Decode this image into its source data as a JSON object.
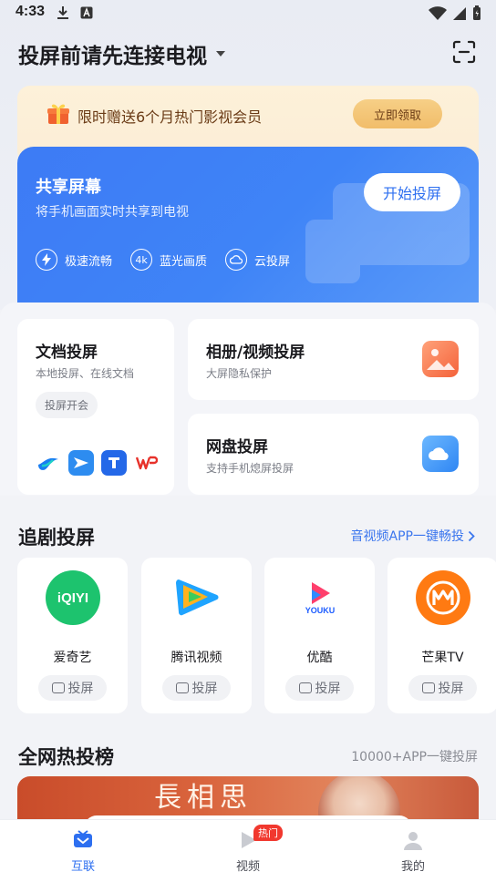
{
  "status_bar": {
    "time": "4:33"
  },
  "header": {
    "title": "投屏前请先连接电视"
  },
  "promo": {
    "text": "限时赠送6个月热门影视会员",
    "button": "立即领取"
  },
  "share": {
    "title": "共享屏幕",
    "subtitle": "将手机画面实时共享到电视",
    "button": "开始投屏",
    "features": [
      {
        "icon": "lightning-icon",
        "label": "极速流畅"
      },
      {
        "icon": "4k-icon",
        "label": "蓝光画质",
        "glyph": "4k"
      },
      {
        "icon": "cloud-icon",
        "label": "云投屏"
      }
    ]
  },
  "tiles": {
    "doc": {
      "title": "文档投屏",
      "subtitle": "本地投屏、在线文档",
      "chip": "投屏开会"
    },
    "album": {
      "title": "相册/视频投屏",
      "subtitle": "大屏隐私保护"
    },
    "netdisk": {
      "title": "网盘投屏",
      "subtitle": "支持手机熄屏投屏"
    }
  },
  "drama": {
    "title": "追剧投屏",
    "link": "音视频APP一键畅投",
    "apps": [
      {
        "name": "爱奇艺",
        "cast": "投屏",
        "logo_text": "iQIYI"
      },
      {
        "name": "腾讯视频",
        "cast": "投屏"
      },
      {
        "name": "优酷",
        "cast": "投屏",
        "logo_text": "YOUKU"
      },
      {
        "name": "芒果TV",
        "cast": "投屏"
      }
    ]
  },
  "hot": {
    "title": "全网热投榜",
    "aside": "10000+APP一键投屏",
    "banner_text": "長相思"
  },
  "nav": {
    "items": [
      {
        "label": "互联"
      },
      {
        "label": "视频",
        "badge": "热门"
      },
      {
        "label": "我的"
      }
    ]
  }
}
